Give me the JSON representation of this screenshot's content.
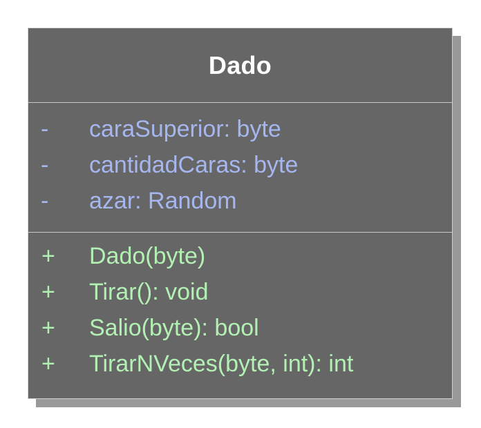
{
  "class_box": {
    "name": "Dado",
    "attributes": [
      {
        "visibility": "-",
        "signature": "caraSuperior: byte"
      },
      {
        "visibility": "-",
        "signature": "cantidadCaras: byte"
      },
      {
        "visibility": "-",
        "signature": "azar: Random"
      }
    ],
    "operations": [
      {
        "visibility": "+",
        "signature": "Dado(byte)"
      },
      {
        "visibility": "+",
        "signature": "Tirar(): void"
      },
      {
        "visibility": "+",
        "signature": "Salio(byte): bool"
      },
      {
        "visibility": "+",
        "signature": "TirarNVeces(byte, int): int"
      }
    ]
  },
  "colors": {
    "box_fill": "#666666",
    "shadow": "#999999",
    "title_text": "#ffffff",
    "attribute_text": "#a6b6ee",
    "operation_text": "#b3f0b3"
  }
}
